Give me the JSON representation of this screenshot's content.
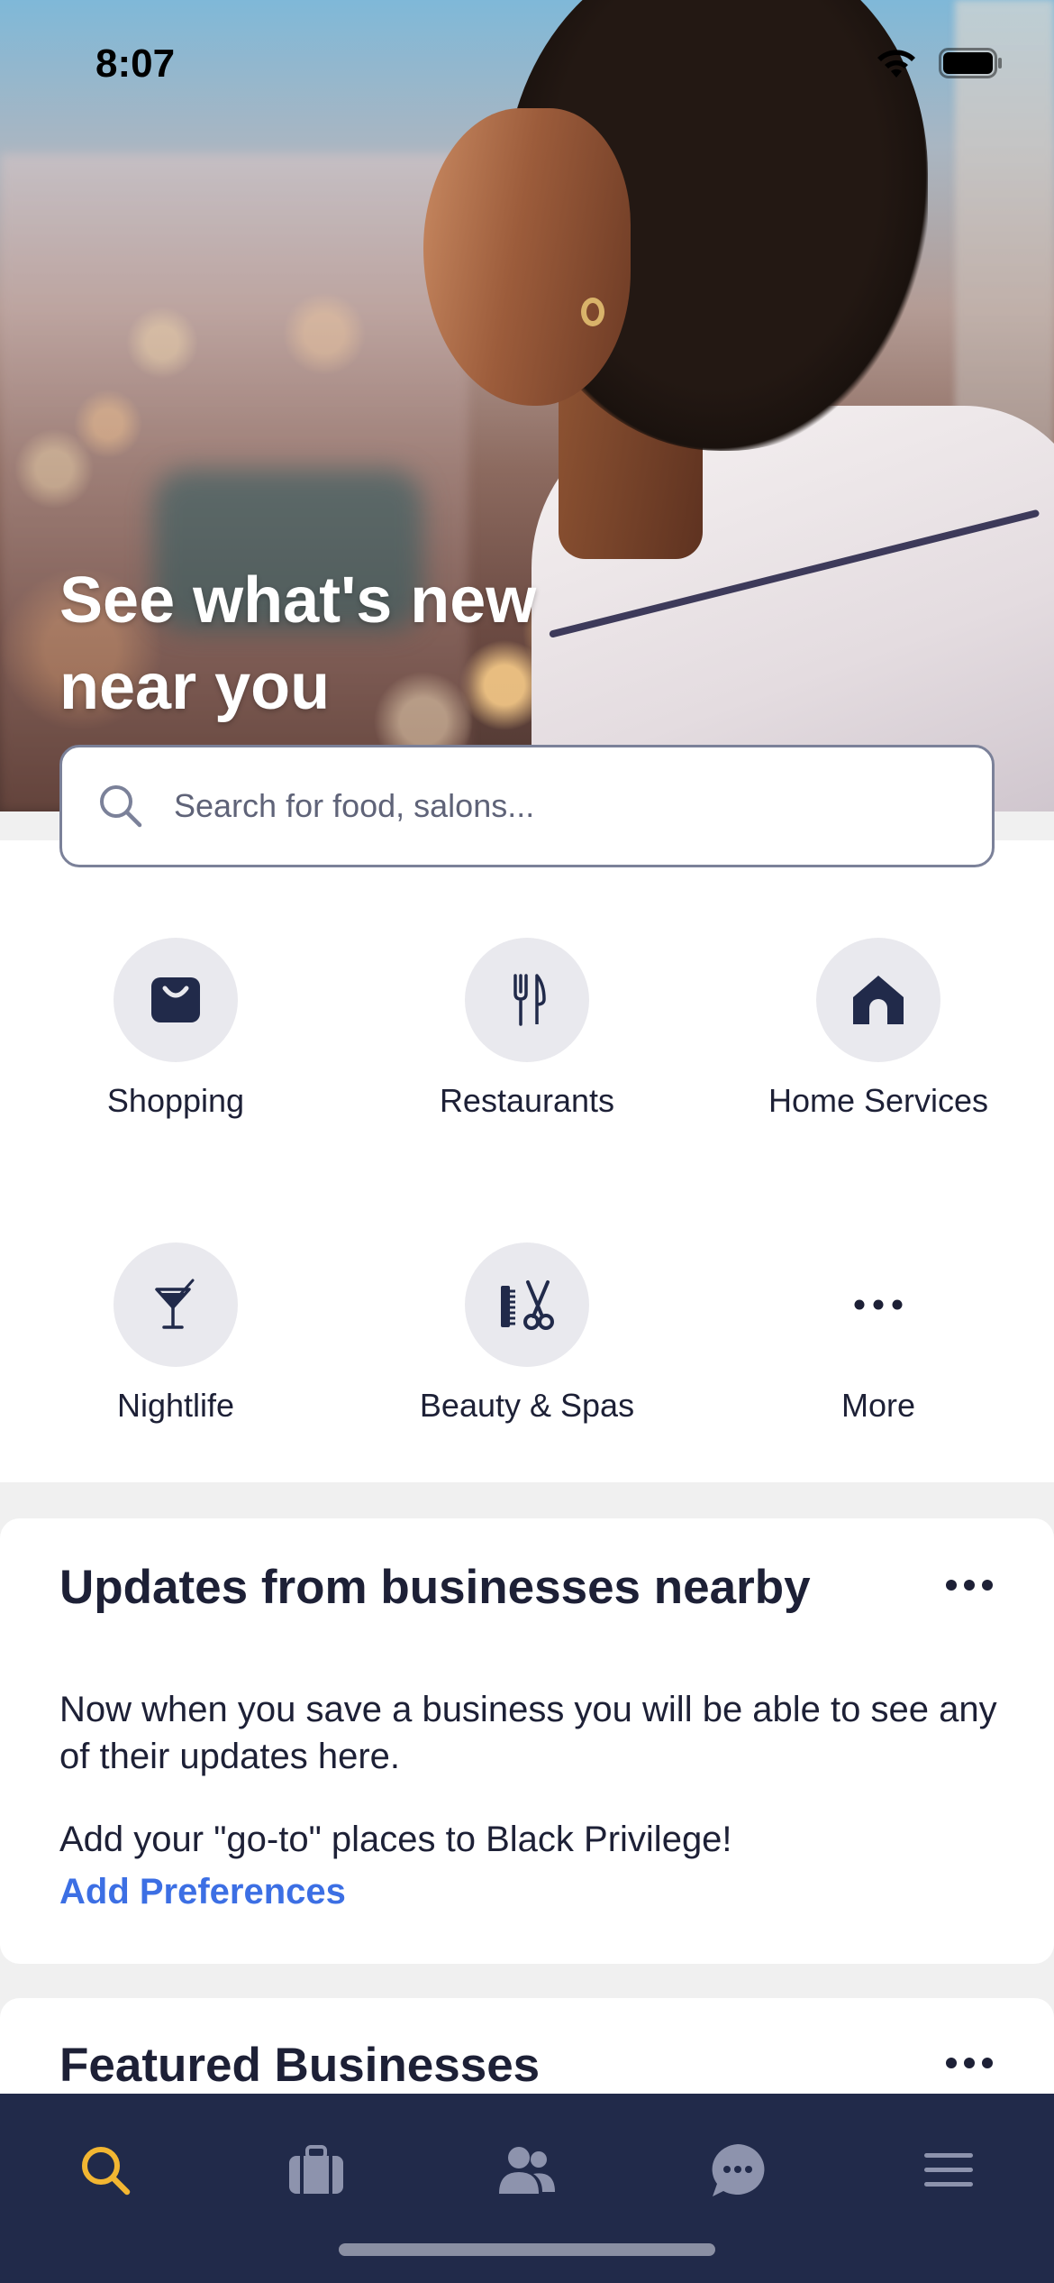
{
  "status_bar": {
    "time": "8:07"
  },
  "hero": {
    "title_line1": "See what's new",
    "title_line2": "near you"
  },
  "search": {
    "placeholder": "Search for food, salons..."
  },
  "categories": [
    {
      "label": "Shopping",
      "icon": "shopping-bag-icon"
    },
    {
      "label": "Restaurants",
      "icon": "fork-knife-icon"
    },
    {
      "label": "Home Services",
      "icon": "house-icon"
    },
    {
      "label": "Nightlife",
      "icon": "cocktail-icon"
    },
    {
      "label": "Beauty & Spas",
      "icon": "comb-scissors-icon"
    },
    {
      "label": "More",
      "icon": "more-dots-icon"
    }
  ],
  "updates": {
    "title": "Updates from businesses nearby",
    "description": "Now when you save a business you will be able to see any of their updates here.",
    "prompt": "Add your \"go-to\" places to Black Privilege!",
    "link": "Add Preferences"
  },
  "featured": {
    "title": "Featured Businesses"
  },
  "tabbar": {
    "tabs": [
      {
        "icon": "search-icon",
        "active": true
      },
      {
        "icon": "briefcase-icon",
        "active": false
      },
      {
        "icon": "people-icon",
        "active": false
      },
      {
        "icon": "chat-bubble-icon",
        "active": false
      },
      {
        "icon": "hamburger-menu-icon",
        "active": false
      }
    ]
  },
  "colors": {
    "accent_active": "#f2b632",
    "tab_inactive": "#8d93ad",
    "tabbar_bg": "#212a4a",
    "link": "#3c6fe4",
    "text": "#1d2036"
  }
}
